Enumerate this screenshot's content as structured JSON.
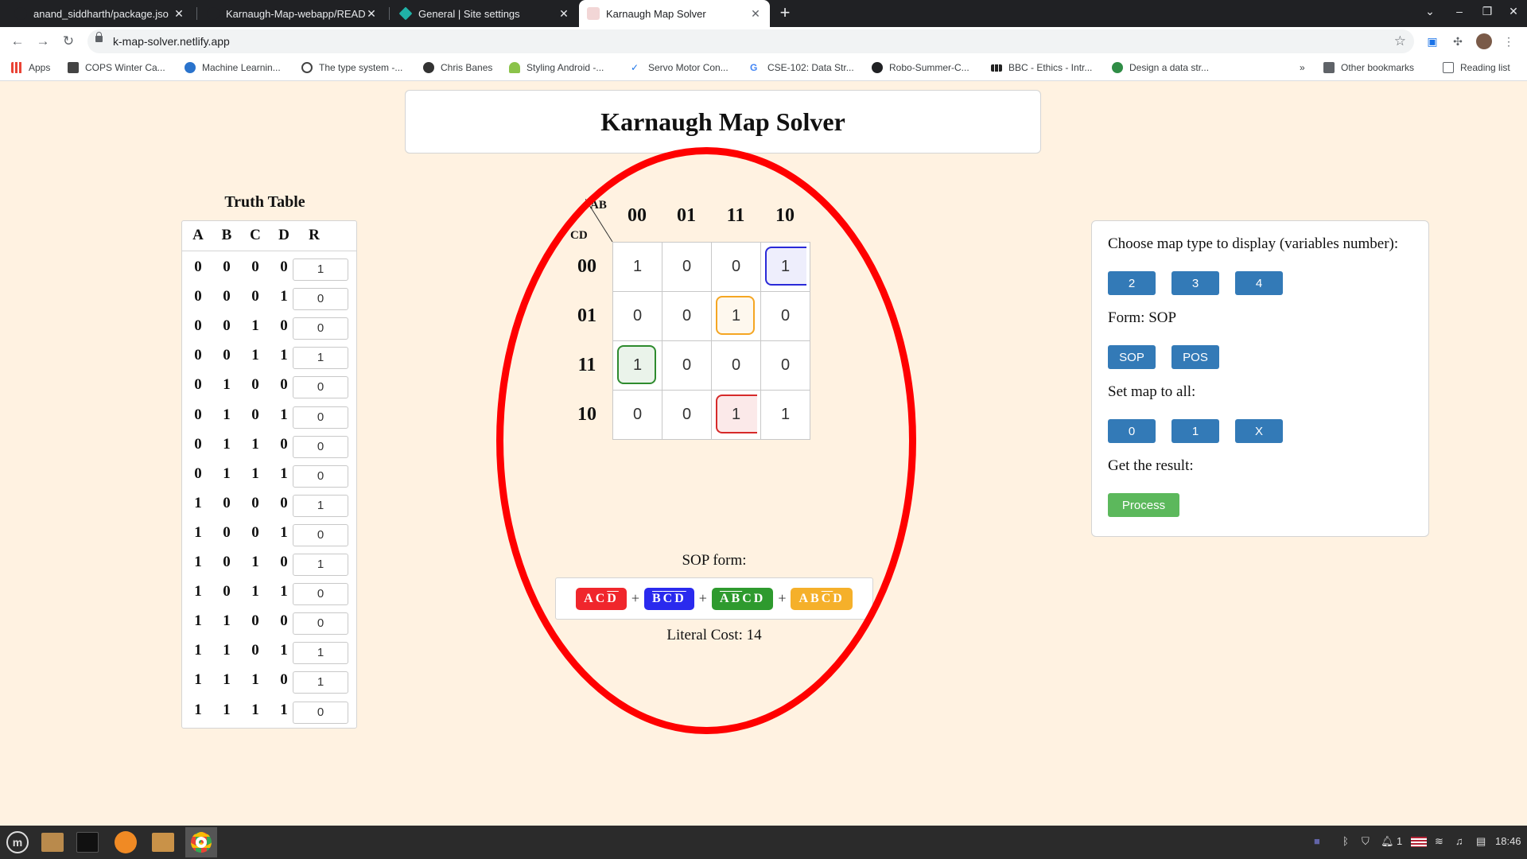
{
  "browser": {
    "tabs": [
      {
        "title": "anand_siddharth/package.jso",
        "active": false
      },
      {
        "title": "Karnaugh-Map-webapp/READ",
        "active": false
      },
      {
        "title": "General | Site settings",
        "active": false
      },
      {
        "title": "Karnaugh Map Solver",
        "active": true
      }
    ],
    "url": "k-map-solver.netlify.app",
    "bookmarks": [
      "Apps",
      "COPS Winter Ca...",
      "Machine Learnin...",
      "The type system -...",
      "Chris Banes",
      "Styling Android -...",
      "Servo Motor Con...",
      "CSE-102: Data Str...",
      "Robo-Summer-C...",
      "BBC - Ethics - Intr...",
      "Design a data str..."
    ],
    "other_bookmarks": "Other bookmarks",
    "reading_list": "Reading list",
    "overflow": "»"
  },
  "page": {
    "title": "Karnaugh Map Solver"
  },
  "truth_table": {
    "title": "Truth Table",
    "headers": [
      "A",
      "B",
      "C",
      "D",
      "R"
    ],
    "rows": [
      {
        "a": "0",
        "b": "0",
        "c": "0",
        "d": "0",
        "r": "1"
      },
      {
        "a": "0",
        "b": "0",
        "c": "0",
        "d": "1",
        "r": "0"
      },
      {
        "a": "0",
        "b": "0",
        "c": "1",
        "d": "0",
        "r": "0"
      },
      {
        "a": "0",
        "b": "0",
        "c": "1",
        "d": "1",
        "r": "1"
      },
      {
        "a": "0",
        "b": "1",
        "c": "0",
        "d": "0",
        "r": "0"
      },
      {
        "a": "0",
        "b": "1",
        "c": "0",
        "d": "1",
        "r": "0"
      },
      {
        "a": "0",
        "b": "1",
        "c": "1",
        "d": "0",
        "r": "0"
      },
      {
        "a": "0",
        "b": "1",
        "c": "1",
        "d": "1",
        "r": "0"
      },
      {
        "a": "1",
        "b": "0",
        "c": "0",
        "d": "0",
        "r": "1"
      },
      {
        "a": "1",
        "b": "0",
        "c": "0",
        "d": "1",
        "r": "0"
      },
      {
        "a": "1",
        "b": "0",
        "c": "1",
        "d": "0",
        "r": "1"
      },
      {
        "a": "1",
        "b": "0",
        "c": "1",
        "d": "1",
        "r": "0"
      },
      {
        "a": "1",
        "b": "1",
        "c": "0",
        "d": "0",
        "r": "0"
      },
      {
        "a": "1",
        "b": "1",
        "c": "0",
        "d": "1",
        "r": "1"
      },
      {
        "a": "1",
        "b": "1",
        "c": "1",
        "d": "0",
        "r": "1"
      },
      {
        "a": "1",
        "b": "1",
        "c": "1",
        "d": "1",
        "r": "0"
      }
    ]
  },
  "kmap": {
    "ab_label": "AB",
    "cd_label": "CD",
    "col_headers": [
      "00",
      "01",
      "11",
      "10"
    ],
    "row_headers": [
      "00",
      "01",
      "11",
      "10"
    ],
    "cells": [
      [
        {
          "value": "1",
          "group": ""
        },
        {
          "value": "0",
          "group": ""
        },
        {
          "value": "0",
          "group": ""
        },
        {
          "value": "1",
          "group": "blue"
        }
      ],
      [
        {
          "value": "0",
          "group": ""
        },
        {
          "value": "0",
          "group": ""
        },
        {
          "value": "1",
          "group": "orange"
        },
        {
          "value": "0",
          "group": ""
        }
      ],
      [
        {
          "value": "1",
          "group": "green"
        },
        {
          "value": "0",
          "group": ""
        },
        {
          "value": "0",
          "group": ""
        },
        {
          "value": "0",
          "group": ""
        }
      ],
      [
        {
          "value": "0",
          "group": ""
        },
        {
          "value": "0",
          "group": ""
        },
        {
          "value": "1",
          "group": "red"
        },
        {
          "value": "1",
          "group": ""
        }
      ]
    ]
  },
  "result": {
    "form_label": "SOP form:",
    "terms": [
      {
        "color": "#f0262c",
        "vars": [
          {
            "v": "A",
            "bar": false
          },
          {
            "v": "C",
            "bar": false
          },
          {
            "v": "D",
            "bar": true
          }
        ]
      },
      {
        "color": "#2a2aee",
        "vars": [
          {
            "v": "B",
            "bar": true
          },
          {
            "v": "C",
            "bar": true
          },
          {
            "v": "D",
            "bar": true
          }
        ]
      },
      {
        "color": "#2e9a2e",
        "vars": [
          {
            "v": "A",
            "bar": true
          },
          {
            "v": "B",
            "bar": true
          },
          {
            "v": "C",
            "bar": false
          },
          {
            "v": "D",
            "bar": false
          }
        ]
      },
      {
        "color": "#f5b02a",
        "vars": [
          {
            "v": "A",
            "bar": false
          },
          {
            "v": "B",
            "bar": false
          },
          {
            "v": "C",
            "bar": true
          },
          {
            "v": "D",
            "bar": false
          }
        ]
      }
    ],
    "plus": "+",
    "literal_cost": "Literal Cost: 14"
  },
  "panel": {
    "map_type_label": "Choose map type to display (variables number):",
    "map_type_buttons": [
      "2",
      "3",
      "4"
    ],
    "form_label": "Form: SOP",
    "form_buttons": [
      "SOP",
      "POS"
    ],
    "set_all_label": "Set map to all:",
    "set_all_buttons": [
      "0",
      "1",
      "X"
    ],
    "result_label": "Get the result:",
    "process_button": "Process"
  },
  "taskbar": {
    "clock": "18:46",
    "notif_count": "1"
  },
  "colors": {
    "page_bg": "#fff2e1",
    "primary_button": "#337ab7",
    "process_button": "#5cb85c",
    "highlight_circle": "#ff0000",
    "group_blue": "#2a2ad8",
    "group_orange": "#f5a623",
    "group_green": "#2e8b2e",
    "group_red": "#d62a2a"
  }
}
